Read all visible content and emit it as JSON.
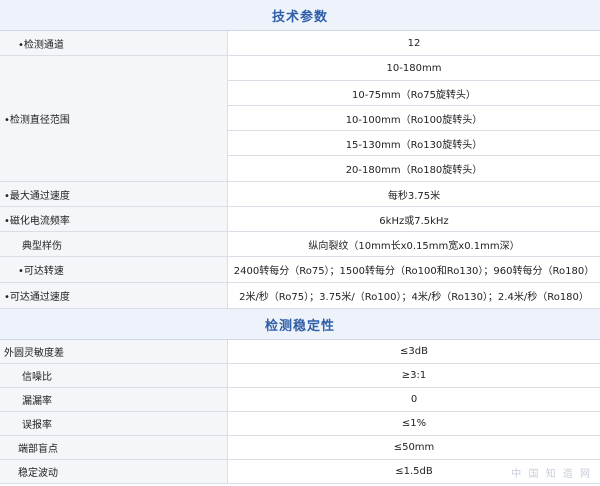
{
  "sections": {
    "tech_title": "技术参数",
    "stability_title": "检测稳定性"
  },
  "tech": {
    "channels": {
      "label": "•检测通道",
      "value": "12"
    },
    "diameter": {
      "label": "•检测直径范围",
      "values": [
        "10-180mm",
        "10-75mm（Ro75旋转头）",
        "10-100mm（Ro100旋转头）",
        "15-130mm（Ro130旋转头）",
        "20-180mm（Ro180旋转头）"
      ]
    },
    "max_speed": {
      "label": "•最大通过速度",
      "value": "每秒3.75米"
    },
    "mag_freq": {
      "label": "•磁化电流频率",
      "value": "6kHz或7.5kHz"
    },
    "typical_flaw": {
      "label": "典型样伤",
      "value": "纵向裂纹（10mm长x0.15mm宽x0.1mm深）"
    },
    "rot_speed": {
      "label": "•可达转速",
      "value": "2400转每分（Ro75）；1500转每分（Ro100和Ro130）；960转每分（Ro180）"
    },
    "pass_speed": {
      "label": "•可达通过速度",
      "value": "2米/秒（Ro75）；3.75米/（Ro100）；4米/秒（Ro130）；2.4米/秒（Ro180）"
    }
  },
  "stability": {
    "sensitivity": {
      "label": "外圆灵敏度差",
      "value": "≤3dB"
    },
    "snr": {
      "label": "信噪比",
      "value": "≥3:1"
    },
    "miss_rate": {
      "label": "漏漏率",
      "value": "0"
    },
    "false_rate": {
      "label": "误报率",
      "value": "≤1%"
    },
    "blind_end": {
      "label": "端部盲点",
      "value": "≤50mm"
    },
    "fluctuation": {
      "label": "稳定波动",
      "value": "≤1.5dB"
    }
  },
  "watermark": "中 国 知 造 网"
}
